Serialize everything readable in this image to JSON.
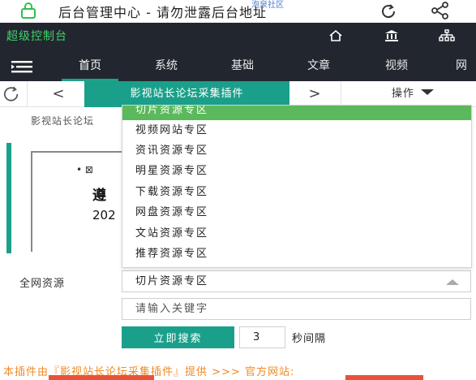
{
  "browser": {
    "address_text": "后台管理中心 - 请勿泄露后台地址",
    "watermark": "泡泉社区"
  },
  "header": {
    "title": "超级控制台",
    "icons": [
      "home-icon",
      "bank-icon",
      "sitemap-icon"
    ]
  },
  "nav": {
    "tabs": [
      {
        "label": "首页",
        "active": true
      },
      {
        "label": "系统",
        "active": false
      },
      {
        "label": "基础",
        "active": false
      },
      {
        "label": "文章",
        "active": false
      },
      {
        "label": "视频",
        "active": false
      },
      {
        "label": "网",
        "active": false
      }
    ]
  },
  "toolbar": {
    "prev": "<",
    "active_tab": "影视站长论坛采集插件",
    "next": ">",
    "ops_label": "操作"
  },
  "page": {
    "crumb": "影视站长论坛",
    "notice_bullet": "• ⊠",
    "notice_big": "遵",
    "notice_year": "202"
  },
  "dropdown": {
    "options": [
      {
        "label": "切片资源专区",
        "selected": true
      },
      {
        "label": "视频网站专区",
        "selected": false
      },
      {
        "label": "资讯资源专区",
        "selected": false
      },
      {
        "label": "明星资源专区",
        "selected": false
      },
      {
        "label": "下载资源专区",
        "selected": false
      },
      {
        "label": "网盘资源专区",
        "selected": false
      },
      {
        "label": "文站资源专区",
        "selected": false
      },
      {
        "label": "推荐资源专区",
        "selected": false
      }
    ]
  },
  "form": {
    "source_label": "全网资源",
    "selected_value": "切片资源专区",
    "keyword_placeholder": "请输入关键字",
    "search_button": "立即搜索",
    "interval_value": "3",
    "interval_label": "秒间隔"
  },
  "footer": {
    "note": "本插件由『影视站长论坛采集插件』提供 >>> 官方网站:"
  },
  "colors": {
    "accent": "#1aa08a",
    "header_bg": "#22272f",
    "title_green": "#3fd36a",
    "selected_option": "#5cb85c",
    "footer_orange": "#f08a24"
  }
}
